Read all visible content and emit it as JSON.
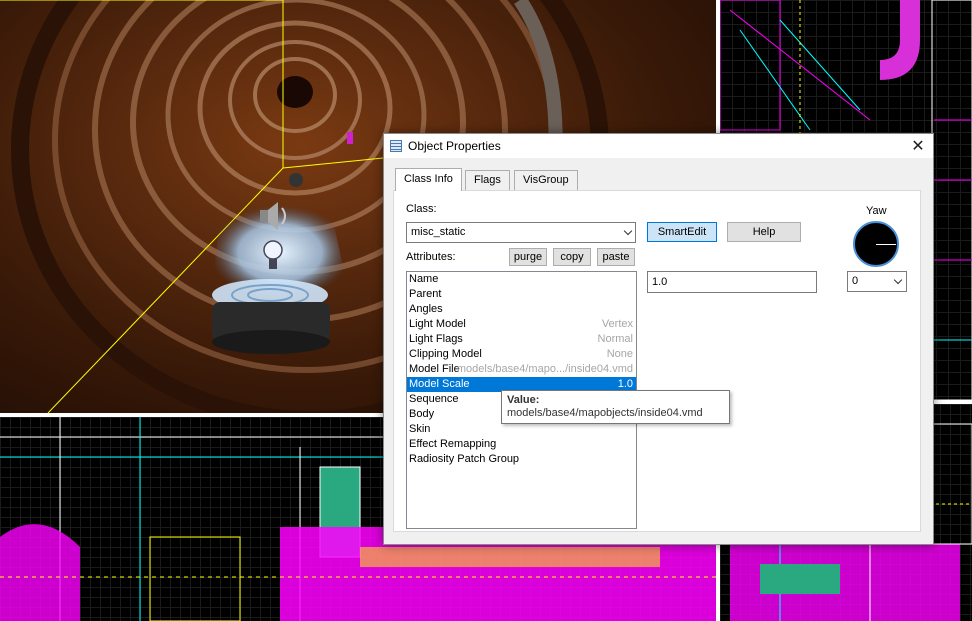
{
  "dialog": {
    "title": "Object Properties",
    "close_glyph": "✕",
    "tabs": [
      {
        "label": "Class Info",
        "active": true
      },
      {
        "label": "Flags",
        "active": false
      },
      {
        "label": "VisGroup",
        "active": false
      }
    ],
    "class_label": "Class:",
    "class_value": "misc_static",
    "smartedit_label": "SmartEdit",
    "help_label": "Help",
    "attributes_label": "Attributes:",
    "purge_label": "purge",
    "copy_label": "copy",
    "paste_label": "paste",
    "attributes": [
      {
        "name": "Name",
        "value": ""
      },
      {
        "name": "Parent",
        "value": ""
      },
      {
        "name": "Angles",
        "value": ""
      },
      {
        "name": "Light Model",
        "value": "Vertex"
      },
      {
        "name": "Light Flags",
        "value": "Normal"
      },
      {
        "name": "Clipping Model",
        "value": "None"
      },
      {
        "name": "Model File",
        "value": "models/base4/mapo.../inside04.vmd"
      },
      {
        "name": "Model Scale",
        "value": "1.0",
        "selected": true
      },
      {
        "name": "Sequence",
        "value": ""
      },
      {
        "name": "Body",
        "value": ""
      },
      {
        "name": "Skin",
        "value": ""
      },
      {
        "name": "Effect Remapping",
        "value": ""
      },
      {
        "name": "Radiosity Patch Group",
        "value": ""
      }
    ],
    "value_field": "1.0",
    "yaw_label": "Yaw",
    "yaw_value": "0",
    "tooltip_title": "Value:",
    "tooltip_text": "models/base4/mapobjects/inside04.vmd"
  },
  "colors": {
    "accent": "#0078d7",
    "wire_magenta": "#ff00ff",
    "wire_yellow": "#ffff00",
    "wire_cyan": "#00ffff"
  },
  "icons": [
    "window-icon",
    "close-icon",
    "chevron-down-icon",
    "speaker-icon",
    "lightbulb-icon"
  ]
}
